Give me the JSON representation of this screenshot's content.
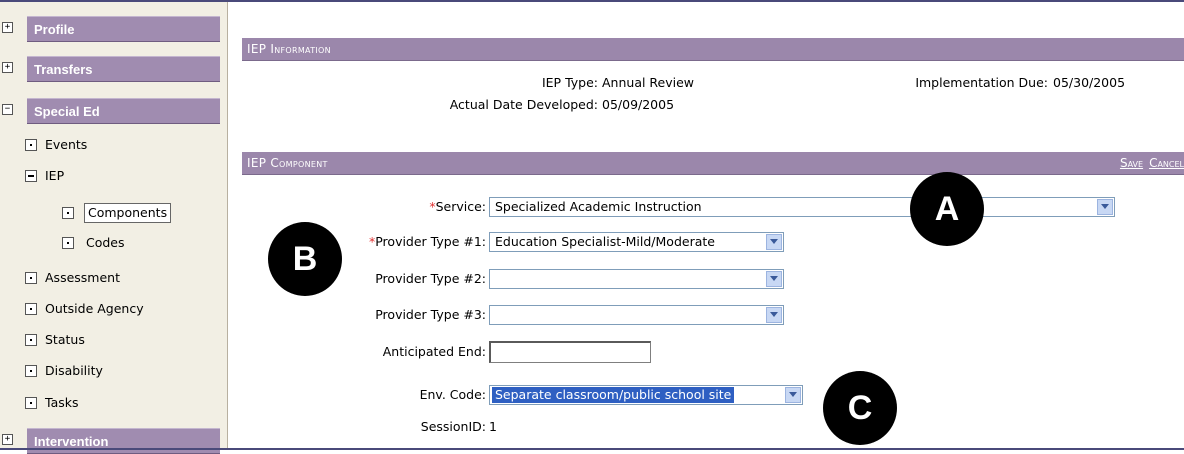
{
  "sidebar": {
    "sections": [
      {
        "label": "Profile",
        "toggle": "+"
      },
      {
        "label": "Transfers",
        "toggle": "+"
      },
      {
        "label": "Special Ed",
        "toggle": "−"
      },
      {
        "label": "Intervention",
        "toggle": "+"
      }
    ],
    "tree": {
      "events": "Events",
      "iep": "IEP",
      "components": "Components",
      "codes": "Codes",
      "assessment": "Assessment",
      "outside_agency": "Outside Agency",
      "status": "Status",
      "disability": "Disability",
      "tasks": "Tasks"
    }
  },
  "iep_info": {
    "title": "IEP Information",
    "type_label": "IEP Type:",
    "type_value": "Annual Review",
    "implementation_label": "Implementation Due:",
    "implementation_value": "05/30/2005",
    "developed_label": "Actual Date Developed:",
    "developed_value": "05/09/2005"
  },
  "iep_component": {
    "title": "IEP Component",
    "save_label": "Save",
    "cancel_label": "Cancel",
    "required_mark": "*",
    "service_label": "Service:",
    "service_value": "Specialized Academic Instruction",
    "provider1_label": "Provider Type #1:",
    "provider1_value": "Education Specialist-Mild/Moderate",
    "provider2_label": "Provider Type #2:",
    "provider2_value": "",
    "provider3_label": "Provider Type #3:",
    "provider3_value": "",
    "anticipated_end_label": "Anticipated End:",
    "anticipated_end_value": "",
    "env_code_label": "Env. Code:",
    "env_code_value": "Separate classroom/public school site",
    "session_label": "SessionID:",
    "session_value": "1"
  },
  "markers": {
    "a": "A",
    "b": "B",
    "c": "C"
  },
  "colors": {
    "section_bar": "#a08cb0",
    "header_bar": "#9b87ab",
    "sidebar_bg": "#f2efe4",
    "select_highlight": "#2e5fc2",
    "required": "#e03030"
  }
}
